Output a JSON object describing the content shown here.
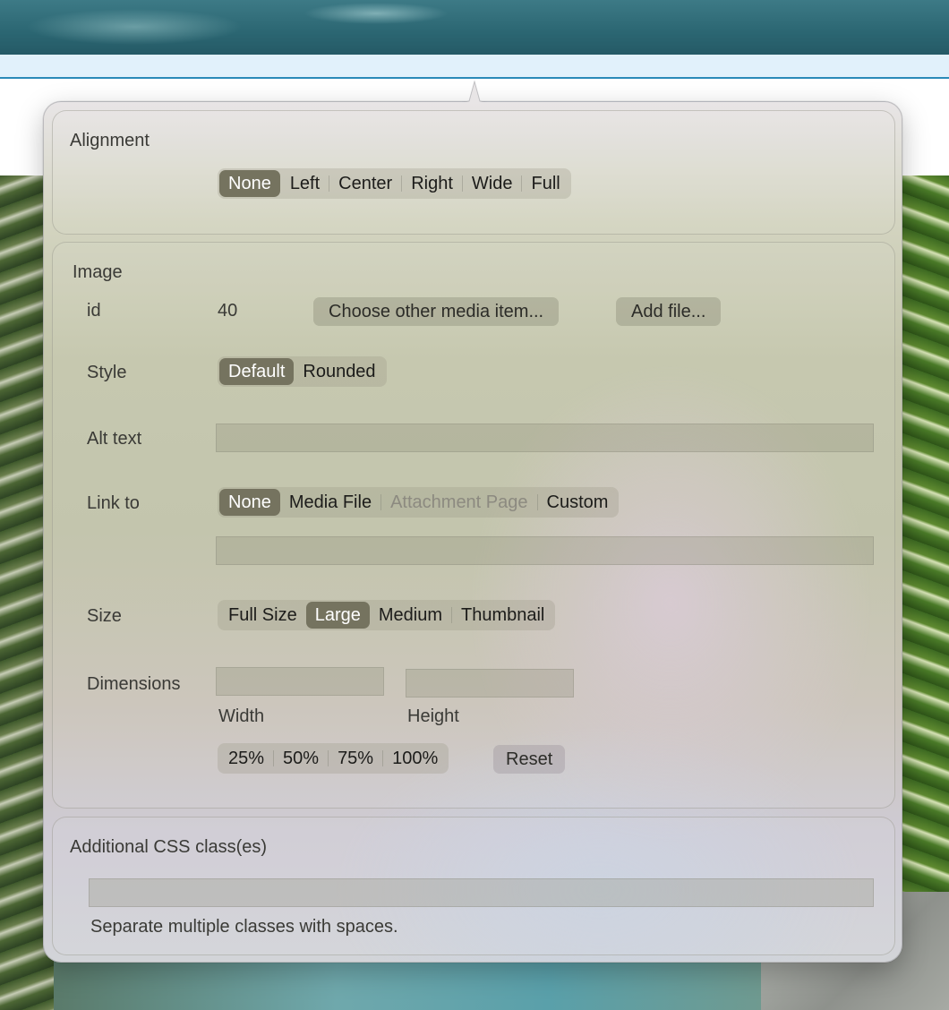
{
  "alignment": {
    "title": "Alignment",
    "options": [
      {
        "label": "None",
        "selected": true
      },
      {
        "label": "Left",
        "selected": false
      },
      {
        "label": "Center",
        "selected": false
      },
      {
        "label": "Right",
        "selected": false
      },
      {
        "label": "Wide",
        "selected": false
      },
      {
        "label": "Full",
        "selected": false
      }
    ]
  },
  "image": {
    "title": "Image",
    "id_label": "id",
    "id_value": "40",
    "choose_media_button": "Choose other media item...",
    "add_file_button": "Add file...",
    "style_label": "Style",
    "style_options": [
      {
        "label": "Default",
        "selected": true
      },
      {
        "label": "Rounded",
        "selected": false
      }
    ],
    "alt_text_label": "Alt text",
    "alt_text_value": "",
    "link_to_label": "Link to",
    "link_to_options": [
      {
        "label": "None",
        "selected": true,
        "disabled": false
      },
      {
        "label": "Media File",
        "selected": false,
        "disabled": false
      },
      {
        "label": "Attachment Page",
        "selected": false,
        "disabled": true
      },
      {
        "label": "Custom",
        "selected": false,
        "disabled": false
      }
    ],
    "link_url_value": "",
    "size_label": "Size",
    "size_options": [
      {
        "label": "Full Size",
        "selected": false
      },
      {
        "label": "Large",
        "selected": true
      },
      {
        "label": "Medium",
        "selected": false
      },
      {
        "label": "Thumbnail",
        "selected": false
      }
    ],
    "dimensions_label": "Dimensions",
    "width_label": "Width",
    "width_value": "",
    "height_label": "Height",
    "height_value": "",
    "scale_options": [
      {
        "label": "25%"
      },
      {
        "label": "50%"
      },
      {
        "label": "75%"
      },
      {
        "label": "100%"
      }
    ],
    "reset_button": "Reset"
  },
  "css": {
    "title": "Additional CSS class(es)",
    "value": "",
    "hint": "Separate multiple classes with spaces."
  },
  "colors": {
    "selected_segment": "#75735f",
    "accent_line": "#2a8ab8"
  }
}
